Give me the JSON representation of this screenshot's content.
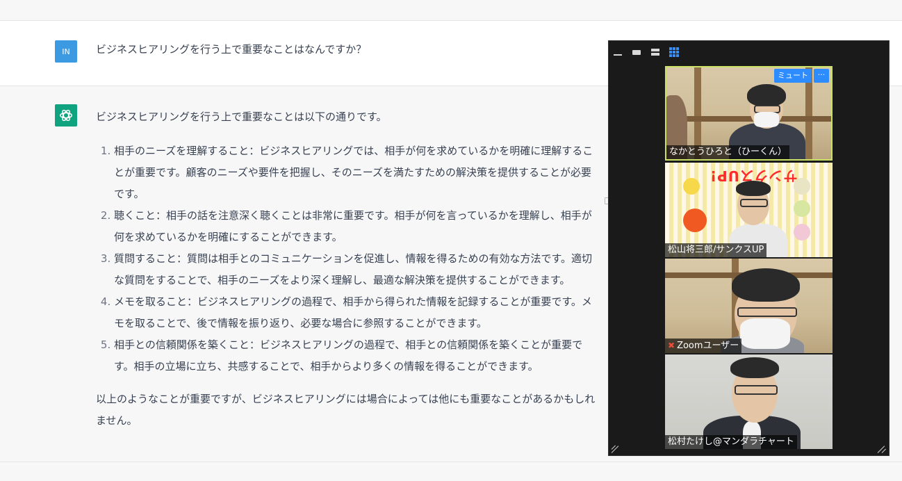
{
  "question": {
    "avatar": "IN",
    "text": "ビジネスヒアリングを行う上で重要なことはなんですか？"
  },
  "answer": {
    "intro": "ビジネスヒアリングを行う上で重要なことは以下の通りです。",
    "items": [
      "相手のニーズを理解すること：ビジネスヒアリングでは、相手が何を求めているかを明確に理解することが重要です。顧客のニーズや要件を把握し、そのニーズを満たすための解決策を提供することが必要です。",
      "聴くこと：相手の話を注意深く聴くことは非常に重要です。相手が何を言っているかを理解し、相手が何を求めているかを明確にすることができます。",
      "質問すること：質問は相手とのコミュニケーションを促進し、情報を得るための有効な方法です。適切な質問をすることで、相手のニーズをより深く理解し、最適な解決策を提供することができます。",
      "メモを取ること：ビジネスヒアリングの過程で、相手から得られた情報を記録することが重要です。メモを取ることで、後で情報を振り返り、必要な場合に参照することができます。",
      "相手との信頼関係を築くこと：ビジネスヒアリングの過程で、相手との信頼関係を築くことが重要です。相手の立場に立ち、共感することで、相手からより多くの情報を得ることができます。"
    ],
    "conclusion": "以上のようなことが重要ですが、ビジネスヒアリングには場合によっては他にも重要なことがあるかもしれません。"
  },
  "zoom": {
    "participants": [
      {
        "name": "なかとうひろと（ひーくん）",
        "mute_label": "ミュート",
        "more_label": "···"
      },
      {
        "name": "松山将三郎/サンクスUP",
        "poster_title": "サンクスUP!"
      },
      {
        "name": "Zoomユーザー",
        "muted": true
      },
      {
        "name": "松村たけし@マンダラチャート"
      }
    ]
  },
  "colors": {
    "user_avatar": "#3b9ae1",
    "gpt_avatar": "#10a37f",
    "zoom_accent": "#2d8cff",
    "speaker_border": "#c9e265"
  }
}
